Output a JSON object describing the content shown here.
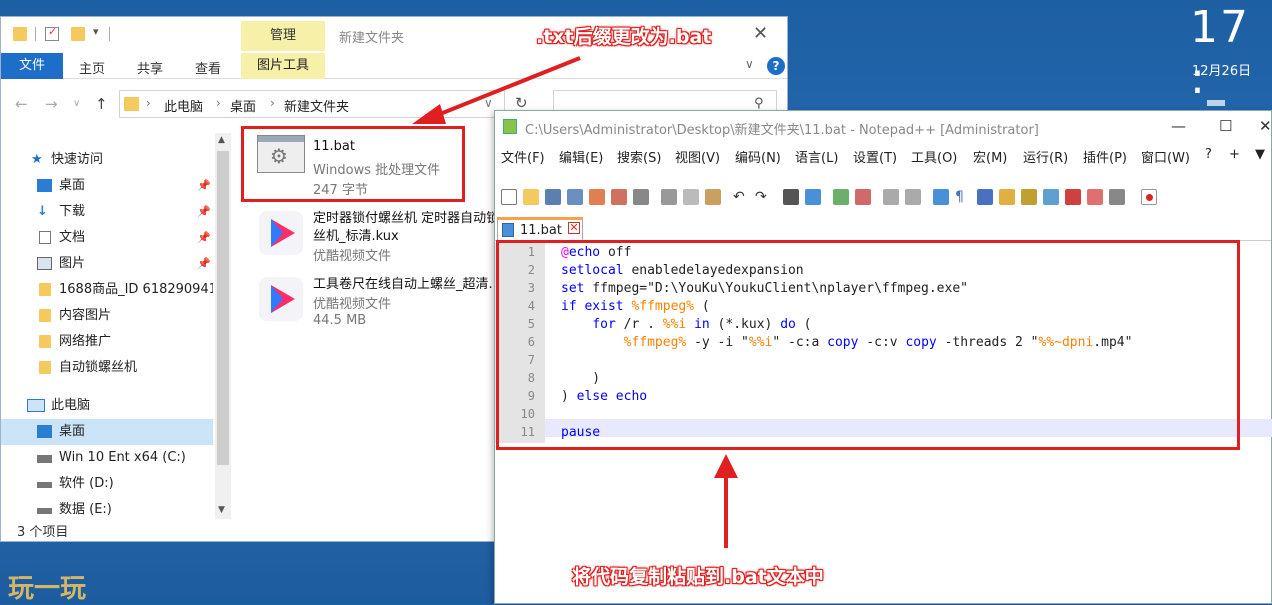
{
  "desktop": {
    "clock_time": "17 :",
    "clock_date": "12月26日"
  },
  "explorer": {
    "ribbon_context_group": "管理",
    "title": "新建文件夹",
    "tabs": [
      "文件",
      "主页",
      "共享",
      "查看"
    ],
    "context_tab": "图片工具",
    "breadcrumb": [
      "此电脑",
      "桌面",
      "新建文件夹"
    ],
    "nav": {
      "quick_access": "快速访问",
      "items": [
        {
          "label": "桌面",
          "pinned": true
        },
        {
          "label": "下载",
          "pinned": true
        },
        {
          "label": "文档",
          "pinned": true
        },
        {
          "label": "图片",
          "pinned": true
        },
        {
          "label": "1688商品_ID 618290941",
          "pinned": false
        },
        {
          "label": "内容图片",
          "pinned": false
        },
        {
          "label": "网络推广",
          "pinned": false
        },
        {
          "label": "自动锁螺丝机",
          "pinned": false
        }
      ],
      "this_pc": "此电脑",
      "pc_items": [
        "桌面",
        "Win 10 Ent x64 (C:)",
        "软件 (D:)",
        "数据 (E:)"
      ]
    },
    "files": [
      {
        "name": "11.bat",
        "type": "Windows 批处理文件",
        "size": "247 字节"
      },
      {
        "name": "定时器锁付螺丝机 定时器自动锁",
        "name2": "丝机_标清.kux",
        "type": "优酷视频文件",
        "size": ""
      },
      {
        "name": "工具卷尺在线自动上螺丝_超清.",
        "name2": "",
        "type": "优酷视频文件",
        "size": "44.5 MB"
      }
    ],
    "status": "3 个项目"
  },
  "npp": {
    "title": "C:\\Users\\Administrator\\Desktop\\新建文件夹\\11.bat - Notepad++ [Administrator]",
    "menu": [
      "文件(F)",
      "编辑(E)",
      "搜索(S)",
      "视图(V)",
      "编码(N)",
      "语言(L)",
      "设置(T)",
      "工具(O)",
      "宏(M)",
      "运行(R)",
      "插件(P)",
      "窗口(W)",
      "?",
      "+",
      "▼"
    ],
    "tab": "11.bat",
    "line_numbers": [
      "1",
      "2",
      "3",
      "4",
      "5",
      "6",
      "7",
      "8",
      "9",
      "10",
      "11"
    ]
  },
  "annotations": {
    "rename_hint": ".txt后缀更改为.bat",
    "paste_hint": "将代码复制粘贴到.bat文本中"
  },
  "watermark": "玩一玩",
  "colors": {
    "annotation": "#e02020",
    "ribbon_file": "#1c6ec8",
    "context_tab": "#f6f0a8",
    "keyword": "#0000ff",
    "variable": "#ff8000"
  }
}
